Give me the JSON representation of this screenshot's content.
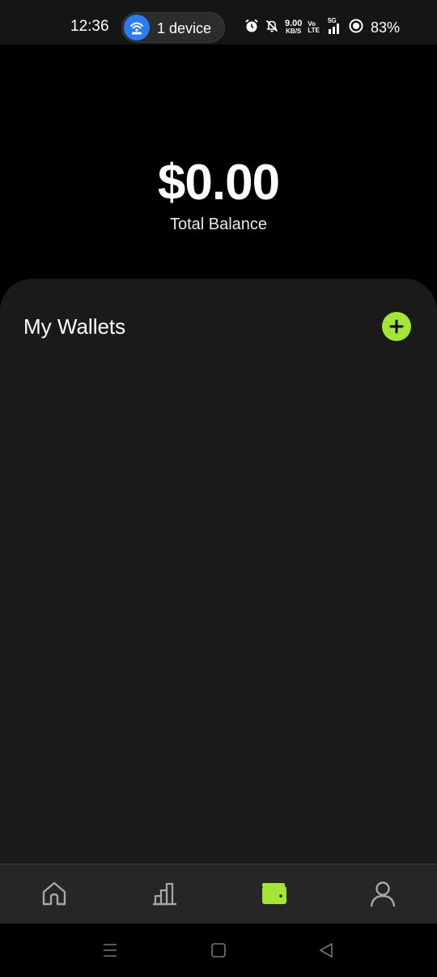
{
  "status_bar": {
    "time": "12:36",
    "hotspot_label": "1 device",
    "speed_value": "9.00",
    "speed_unit": "KB/S",
    "volte_top": "Vo",
    "volte_bottom": "LTE",
    "network": "5G",
    "battery": "83%",
    "icons": [
      "wifi-hotspot-icon",
      "alarm-icon",
      "mute-icon",
      "signal-icon",
      "battery-icon"
    ]
  },
  "balance": {
    "amount": "$0.00",
    "label": "Total Balance"
  },
  "wallets": {
    "title": "My Wallets",
    "add_icon": "plus-icon"
  },
  "tab_bar": {
    "tabs": [
      {
        "name": "home",
        "icon": "home-icon",
        "active": false
      },
      {
        "name": "stats",
        "icon": "bar-chart-icon",
        "active": false
      },
      {
        "name": "wallet",
        "icon": "wallet-icon",
        "active": true
      },
      {
        "name": "profile",
        "icon": "person-icon",
        "active": false
      }
    ]
  },
  "system_nav": {
    "icons": [
      "menu-icon",
      "home-square-icon",
      "back-icon"
    ]
  },
  "colors": {
    "accent": "#a3e635",
    "background": "#000000",
    "panel": "#1a1a1a",
    "tab_bar": "#262626",
    "hotspot": "#2a7bf6"
  }
}
